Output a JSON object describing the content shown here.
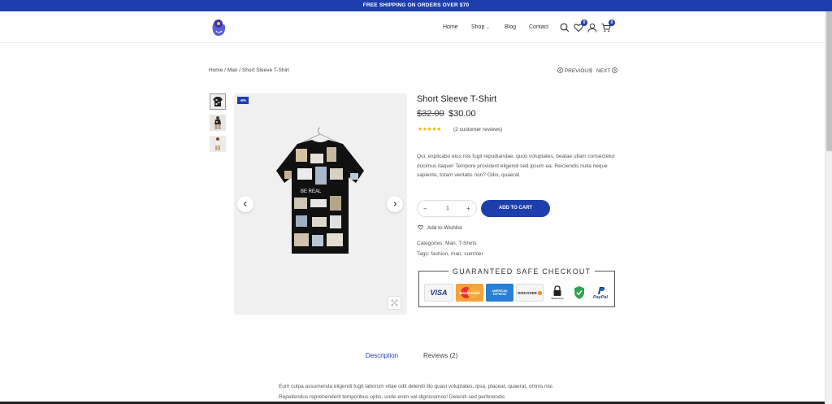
{
  "topbar": {
    "text": "FREE SHIPPING ON ORDERS OVER $70"
  },
  "nav": {
    "items": [
      "Home",
      "Shop",
      "Blog",
      "Contact"
    ],
    "wishlist_count": "0",
    "cart_count": "0"
  },
  "breadcrumb": {
    "home": "Home",
    "sep1": "/",
    "category": "Man",
    "sep2": "/",
    "current": "Short Sleeve T-Shirt"
  },
  "pager": {
    "previous": "PREVIOUS",
    "sep": "|",
    "next": "NEXT"
  },
  "product": {
    "sale_badge": "-6%",
    "title": "Short Sleeve T-Shirt",
    "old_price": "$32.00",
    "price": "$30.00",
    "rating": 5,
    "reviews_link": "(2 customer reviews)",
    "description": "Qui, explicabo eius nisi fugit repudiandae, quos voluptates, beatae ullam consectetur ducimus itaque! Tempore provident eligendi sed ipsum ea. Reiciendis nulla neque sapiente, totam veritatis non? Odio, quaerat.",
    "quantity": "1",
    "qty_minus": "−",
    "qty_plus": "+",
    "add_to_cart": "ADD TO CART",
    "wishlist": "Add to Wishlist",
    "categories_label": "Categories:",
    "categories": "Man, T-Shirts",
    "tags_label": "Tags:",
    "tags": "fashion, man, summer"
  },
  "checkout": {
    "title": "GUARANTEED SAFE CHECKOUT",
    "methods": [
      "VISA",
      "MasterCard",
      "AMERICAN EXPRESS",
      "DISCOVER",
      "Secured by",
      "PayPal"
    ]
  },
  "tabs": {
    "description": "Description",
    "reviews": "Reviews (2)"
  },
  "tab_content": {
    "description": "Eum culpa assumenda eligendi fugit laborum vitae odit deleniti illo quasi voluptates, ipsa, placeat, quaerat, omnis nisi. Repellendus reprehenderit temporibus optio, unde enim vel dignissimos! Deleniti sed perferendis"
  },
  "colors": {
    "accent": "#1d3fae",
    "star": "#f5b301"
  }
}
